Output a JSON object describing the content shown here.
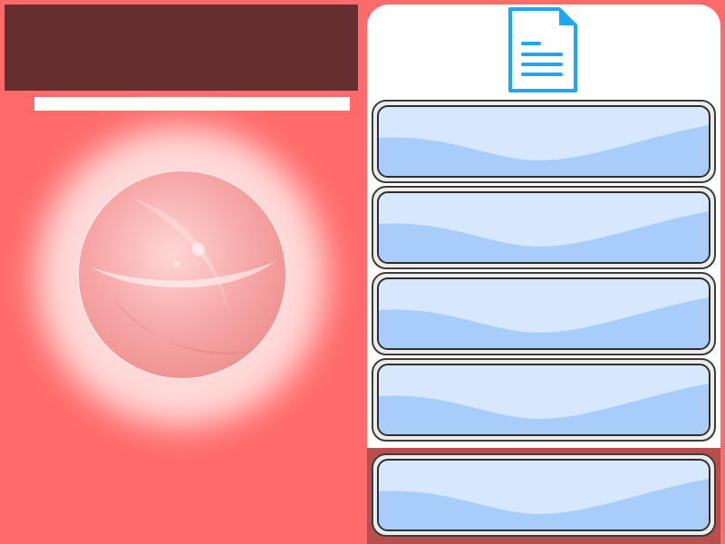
{
  "colors": {
    "background": "#ff6b6b",
    "title_banner": "#662e2e",
    "progress_track": "#ffffff",
    "progress_fill": "#ffffff",
    "orb_glow": "#ffd9d9",
    "orb_fill": "#f9a3a3",
    "panel_background": "#ffffff",
    "highlight_band": "#b84f4f",
    "slot_frame": "#ececec",
    "slot_light": "#d7e8fd",
    "slot_wave": "#a8cdfb",
    "document_icon": "#21a7f0"
  },
  "title_bar": {
    "text": ""
  },
  "progress": {
    "value": 1.0
  },
  "document": {
    "icon": "document-icon"
  },
  "slots": [
    {
      "label": ""
    },
    {
      "label": ""
    },
    {
      "label": ""
    },
    {
      "label": ""
    },
    {
      "label": ""
    }
  ],
  "selected_slot": 5
}
